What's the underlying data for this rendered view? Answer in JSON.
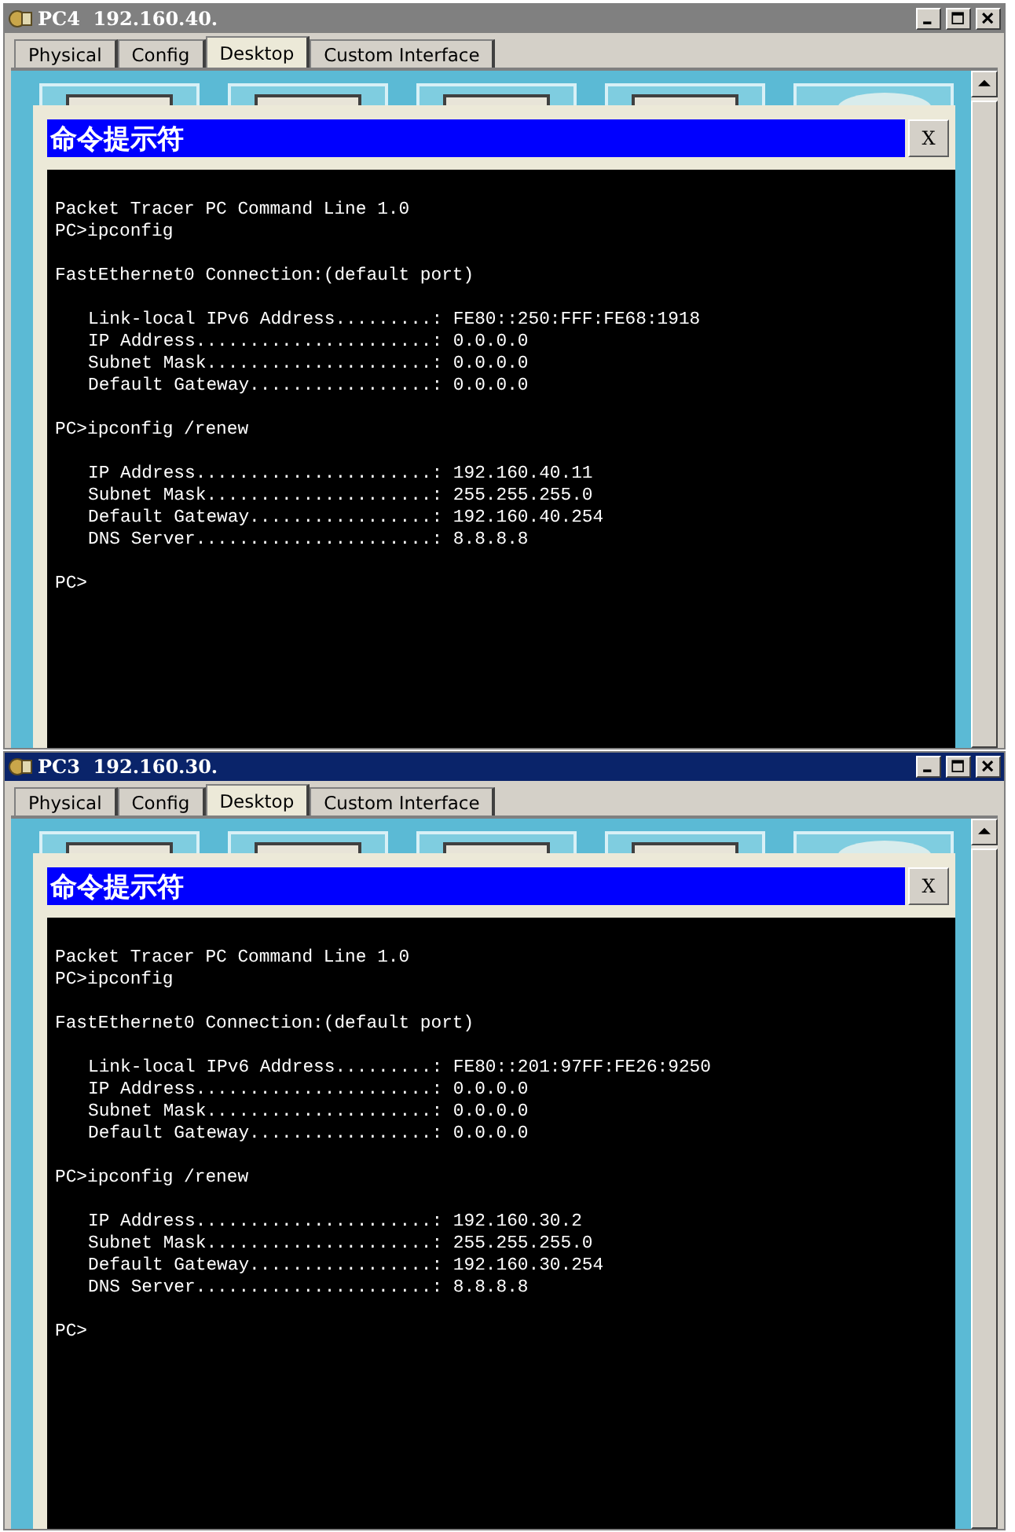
{
  "windows": [
    {
      "title": "PC4  192.160.40.",
      "active": false,
      "tabs": [
        {
          "label": "Physical",
          "selected": false
        },
        {
          "label": "Config",
          "selected": false
        },
        {
          "label": "Desktop",
          "selected": true
        },
        {
          "label": "Custom Interface",
          "selected": false
        }
      ],
      "dialog": {
        "title": "命令提示符",
        "close_label": "X",
        "blocks": [
          {
            "indented": false,
            "lines": [
              "Packet Tracer PC Command Line 1.0",
              "PC>ipconfig"
            ]
          },
          {
            "indented": false,
            "lines": [
              "FastEthernet0 Connection:(default port)"
            ]
          },
          {
            "indented": true,
            "lines": [
              "Link-local IPv6 Address.........: FE80::250:FFF:FE68:1918",
              "IP Address......................: 0.0.0.0",
              "Subnet Mask.....................: 0.0.0.0",
              "Default Gateway.................: 0.0.0.0"
            ]
          },
          {
            "indented": false,
            "lines": [
              "PC>ipconfig /renew"
            ]
          },
          {
            "indented": true,
            "lines": [
              "IP Address......................: 192.160.40.11",
              "Subnet Mask.....................: 255.255.255.0",
              "Default Gateway.................: 192.160.40.254",
              "DNS Server......................: 8.8.8.8"
            ]
          },
          {
            "indented": false,
            "lines": [
              "PC>"
            ]
          }
        ]
      }
    },
    {
      "title": "PC3  192.160.30.",
      "active": true,
      "tabs": [
        {
          "label": "Physical",
          "selected": false
        },
        {
          "label": "Config",
          "selected": false
        },
        {
          "label": "Desktop",
          "selected": true
        },
        {
          "label": "Custom Interface",
          "selected": false
        }
      ],
      "dialog": {
        "title": "命令提示符",
        "close_label": "X",
        "blocks": [
          {
            "indented": false,
            "lines": [
              "Packet Tracer PC Command Line 1.0",
              "PC>ipconfig"
            ]
          },
          {
            "indented": false,
            "lines": [
              "FastEthernet0 Connection:(default port)"
            ]
          },
          {
            "indented": true,
            "lines": [
              "Link-local IPv6 Address.........: FE80::201:97FF:FE26:9250",
              "IP Address......................: 0.0.0.0",
              "Subnet Mask.....................: 0.0.0.0",
              "Default Gateway.................: 0.0.0.0"
            ]
          },
          {
            "indented": false,
            "lines": [
              "PC>ipconfig /renew"
            ]
          },
          {
            "indented": true,
            "lines": [
              "IP Address......................: 192.160.30.2",
              "Subnet Mask.....................: 255.255.255.0",
              "Default Gateway.................: 192.160.30.254",
              "DNS Server......................: 8.8.8.8"
            ]
          },
          {
            "indented": false,
            "lines": [
              "PC>"
            ]
          }
        ]
      }
    }
  ]
}
